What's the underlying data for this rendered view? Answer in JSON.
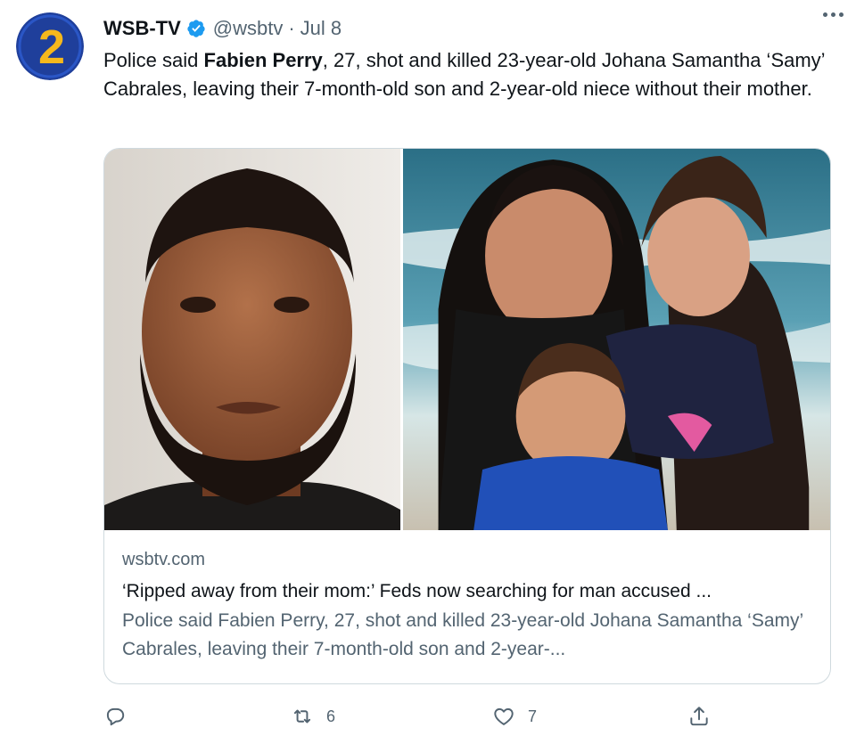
{
  "tweet": {
    "display_name": "WSB-TV",
    "handle": "@wsbtv",
    "separator": "·",
    "date": "Jul 8",
    "text_before": "Police said ",
    "text_bold": "Fabien Perry",
    "text_after": ", 27, shot and killed 23-year-old Johana Samantha ‘Samy’ Cabrales, leaving their 7-month-old son and 2-year-old niece without their mother.",
    "avatar_number": "2"
  },
  "card": {
    "domain": "wsbtv.com",
    "title": "‘Ripped away from their mom:’ Feds now searching for man accused ...",
    "description": "Police said Fabien Perry, 27, shot and killed 23-year-old Johana Samantha ‘Samy’ Cabrales, leaving their 7-month-old son and 2-year-..."
  },
  "actions": {
    "reply_count": "",
    "retweet_count": "6",
    "like_count": "7"
  },
  "colors": {
    "avatar_blue": "#1f3f9b",
    "avatar_yellow": "#f5b81c",
    "verified_blue": "#1d9bf0",
    "secondary_text": "#536471",
    "border": "#cfd9de"
  }
}
